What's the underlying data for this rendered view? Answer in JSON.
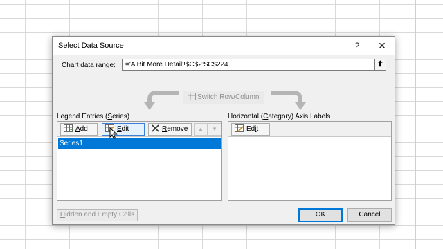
{
  "dialog": {
    "title": "Select Data Source",
    "help_label": "?",
    "close_label": "✕",
    "range_label_pre": "Chart ",
    "range_label_ul": "d",
    "range_label_post": "ata range:",
    "range_value": "='A Bit More Detail'!$C$2:$C$224",
    "collapse_label": "⬆",
    "switch_pre": "",
    "switch_ul": "S",
    "switch_post": "witch Row/Column",
    "legend_label_pre": "Legend Entries (",
    "legend_label_ul": "S",
    "legend_label_post": "eries)",
    "axis_label_pre": "Horizontal (",
    "axis_label_ul": "C",
    "axis_label_post": "ategory) Axis Labels",
    "legend_toolbar": {
      "add_pre": "",
      "add_ul": "A",
      "add_post": "dd",
      "edit_pre": "",
      "edit_ul": "E",
      "edit_post": "dit",
      "remove_pre": "",
      "remove_ul": "R",
      "remove_post": "emove",
      "move_up": "▲",
      "move_down": "▼"
    },
    "axis_toolbar": {
      "edit_pre": "Ed",
      "edit_ul": "i",
      "edit_post": "t"
    },
    "series": [
      {
        "name": "Series1",
        "selected": true
      }
    ],
    "hidden_pre": "",
    "hidden_ul": "H",
    "hidden_post": "idden and Empty Cells",
    "ok_label": "OK",
    "cancel_label": "Cancel"
  },
  "colors": {
    "selection": "#0078d7",
    "dialog_bg": "#f0f0f0",
    "disabled_text": "#8d8d8d"
  },
  "icons": {
    "add": "add-icon",
    "edit": "edit-icon",
    "remove": "remove-icon",
    "switch": "switch-row-column-icon"
  }
}
